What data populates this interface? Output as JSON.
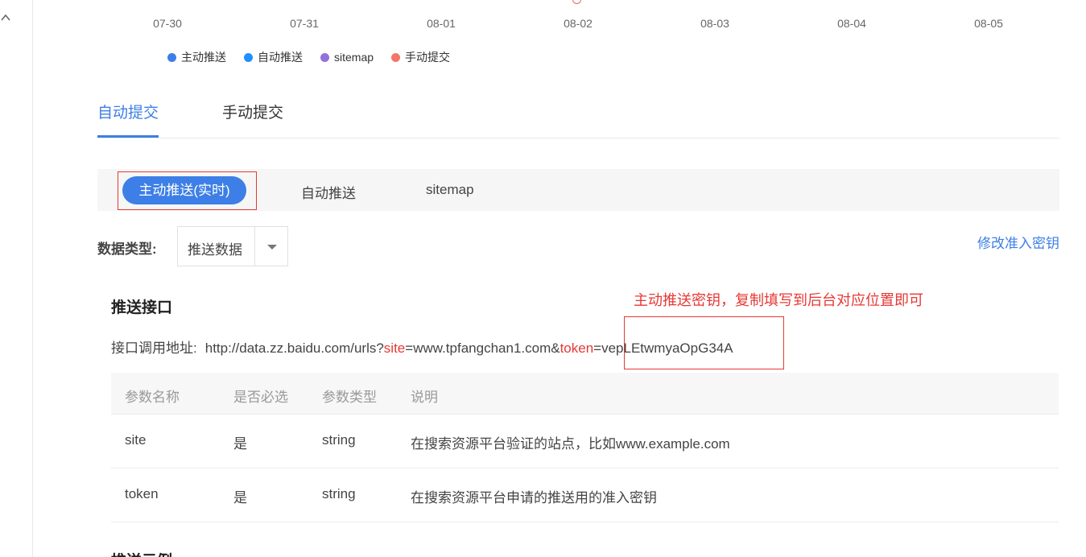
{
  "chart": {
    "x_ticks": [
      "07-30",
      "07-31",
      "08-01",
      "08-02",
      "08-03",
      "08-04",
      "08-05"
    ],
    "legend": [
      {
        "label": "主动推送",
        "color": "#3d7fe6"
      },
      {
        "label": "自动推送",
        "color": "#1e90ff"
      },
      {
        "label": "sitemap",
        "color": "#9370db"
      },
      {
        "label": "手动提交",
        "color": "#f0776a"
      }
    ]
  },
  "main_tabs": [
    {
      "label": "自动提交",
      "active": true
    },
    {
      "label": "手动提交",
      "active": false
    }
  ],
  "sub_tabs": [
    {
      "label": "主动推送(实时)",
      "active": true
    },
    {
      "label": "自动推送",
      "active": false
    },
    {
      "label": "sitemap",
      "active": false
    }
  ],
  "data_type": {
    "label": "数据类型:",
    "selected": "推送数据"
  },
  "modify_key_link": "修改准入密钥",
  "annotation": "主动推送密钥，复制填写到后台对应位置即可",
  "section_title": "推送接口",
  "api": {
    "label": "接口调用地址:",
    "url_prefix": "http://data.zz.baidu.com/urls?",
    "site_key": "site",
    "site_value": "=www.tpfangchan1.com&",
    "token_key": "token",
    "token_value": "=vepLEtwmyaOpG34A"
  },
  "table": {
    "headers": [
      "参数名称",
      "是否必选",
      "参数类型",
      "说明"
    ],
    "rows": [
      [
        "site",
        "是",
        "string",
        "在搜索资源平台验证的站点，比如www.example.com"
      ],
      [
        "token",
        "是",
        "string",
        "在搜索资源平台申请的推送用的准入密钥"
      ]
    ]
  },
  "next_section_title": "推送示例"
}
